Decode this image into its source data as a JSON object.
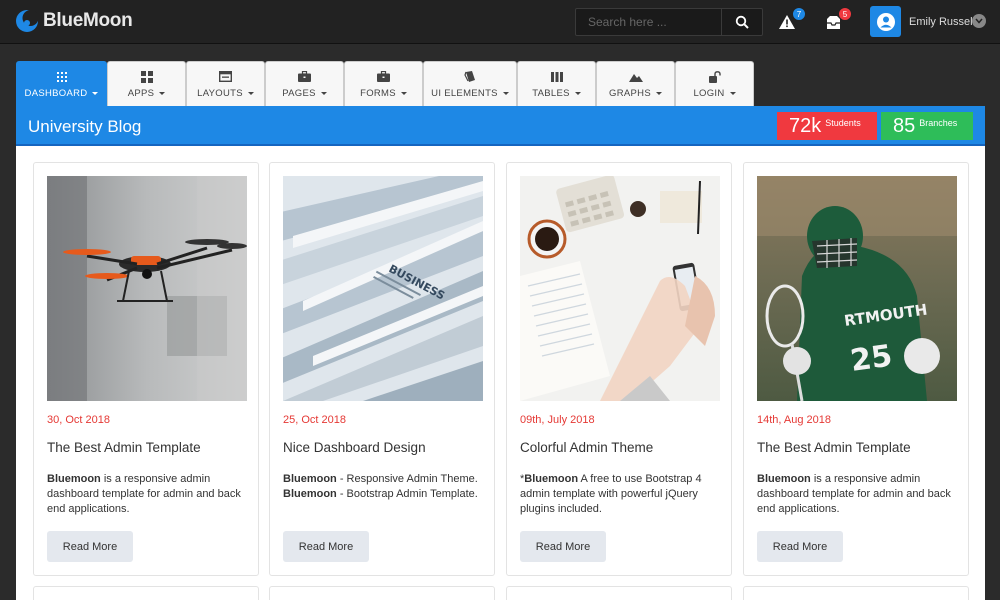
{
  "brand": {
    "name": "BlueMoon"
  },
  "header": {
    "search_placeholder": "Search here ...",
    "alerts_count": "7",
    "messages_count": "5",
    "user_name": "Emily Russell"
  },
  "nav": {
    "tabs": [
      {
        "label": "DASHBOARD",
        "icon": "grid-dots-icon"
      },
      {
        "label": "APPS",
        "icon": "apps-grid-icon"
      },
      {
        "label": "LAYOUTS",
        "icon": "window-icon"
      },
      {
        "label": "PAGES",
        "icon": "briefcase-icon"
      },
      {
        "label": "FORMS",
        "icon": "briefcase-icon"
      },
      {
        "label": "UI ELEMENTS",
        "icon": "paint-icon"
      },
      {
        "label": "TABLES",
        "icon": "columns-icon"
      },
      {
        "label": "GRAPHS",
        "icon": "mountain-icon"
      },
      {
        "label": "LOGIN",
        "icon": "unlock-icon"
      }
    ]
  },
  "page": {
    "title": "University Blog",
    "stats": [
      {
        "value": "72k",
        "label": "Students",
        "color": "#f0393f"
      },
      {
        "value": "85",
        "label": "Branches",
        "color": "#2ebd59"
      }
    ]
  },
  "cards": [
    {
      "date": "30, Oct 2018",
      "title": "The Best Admin Template",
      "desc_bold": "Bluemoon",
      "desc": " is a responsive admin dashboard template for admin and back end applications.",
      "button": "Read More",
      "image": "drone-photo"
    },
    {
      "date": "25, Oct 2018",
      "title": "Nice Dashboard Design",
      "desc_bold": "Bluemoon",
      "desc": " - Responsive Admin Theme.",
      "desc_bold2": "Bluemoon",
      "desc2": " - Bootstrap Admin Template.",
      "button": "Read More",
      "image": "newspapers-photo"
    },
    {
      "date": "09th, July 2018",
      "title": "Colorful Admin Theme",
      "desc_prefix": "*",
      "desc_bold": "Bluemoon",
      "desc": " A free to use Bootstrap 4 admin template with powerful jQuery plugins included.",
      "button": "Read More",
      "image": "desk-phone-photo"
    },
    {
      "date": "14th, Aug 2018",
      "title": "The Best Admin Template",
      "desc_bold": "Bluemoon",
      "desc": " is a responsive admin dashboard template for admin and back end applications.",
      "button": "Read More",
      "image": "lacrosse-player-photo"
    }
  ],
  "colors": {
    "accent": "#1e88e5",
    "date": "#e53935",
    "alert_badge": "#1e88e5",
    "message_badge": "#f0393f"
  }
}
